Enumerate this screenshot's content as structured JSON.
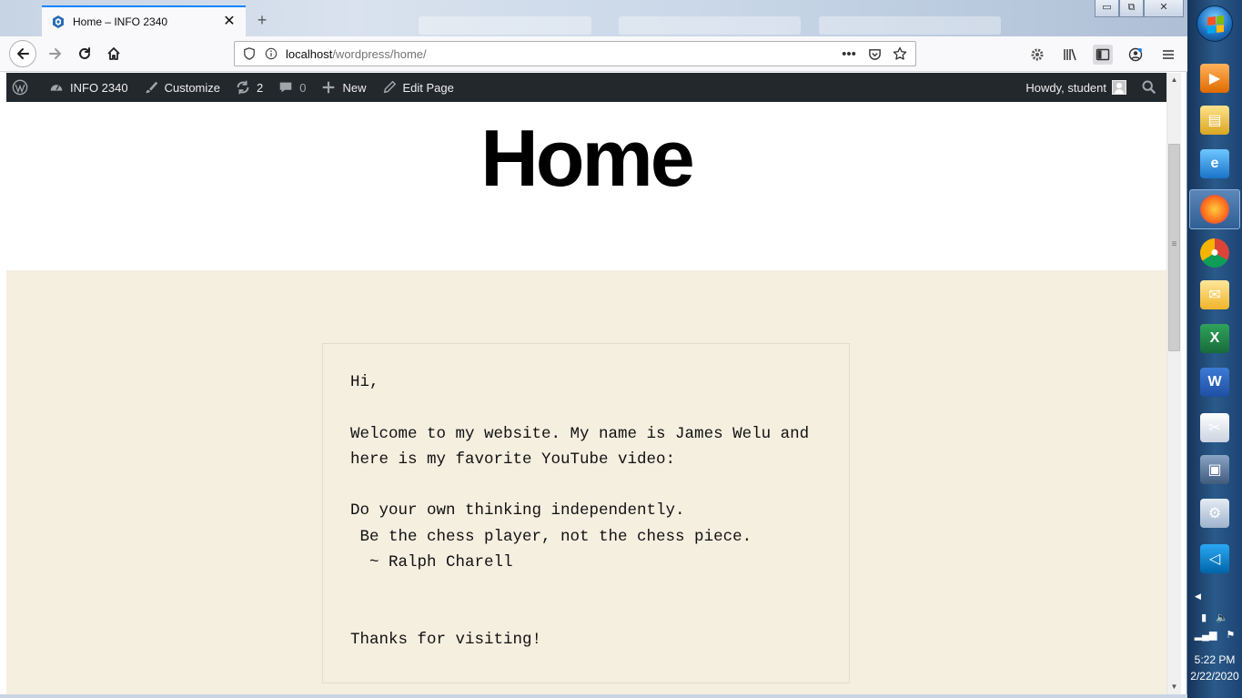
{
  "browser": {
    "tab": {
      "title": "Home – INFO 2340"
    },
    "url": {
      "host": "localhost",
      "path": "/wordpress/home/"
    },
    "url_actions": {
      "more": "•••"
    },
    "window_controls": {
      "minimize": "▭",
      "maximize": "⧉",
      "close": "✕"
    }
  },
  "wp_admin_bar": {
    "site_name": "INFO 2340",
    "customize": "Customize",
    "updates_count": "2",
    "comments_count": "0",
    "new_label": "New",
    "edit_page": "Edit Page",
    "howdy": "Howdy, student"
  },
  "page": {
    "title": "Home",
    "body_lines": [
      "Hi,",
      "",
      "Welcome to my website. My name is James Welu and",
      "here is my favorite YouTube video:",
      "",
      "Do your own thinking independently.",
      " Be the chess player, not the chess piece.",
      "  ~ Ralph Charell",
      "",
      "",
      "Thanks for visiting!"
    ]
  },
  "taskbar": {
    "apps": [
      "media-player",
      "file-explorer",
      "internet-explorer",
      "firefox",
      "chrome",
      "outlook",
      "excel",
      "word",
      "snipping-tool",
      "remote-desktop",
      "settings",
      "vscode"
    ],
    "time": "5:22 PM",
    "date": "2/22/2020"
  },
  "colors": {
    "admin_bar": "#23282d",
    "content_bg": "#f5efe0",
    "tab_accent": "#0a84ff"
  }
}
